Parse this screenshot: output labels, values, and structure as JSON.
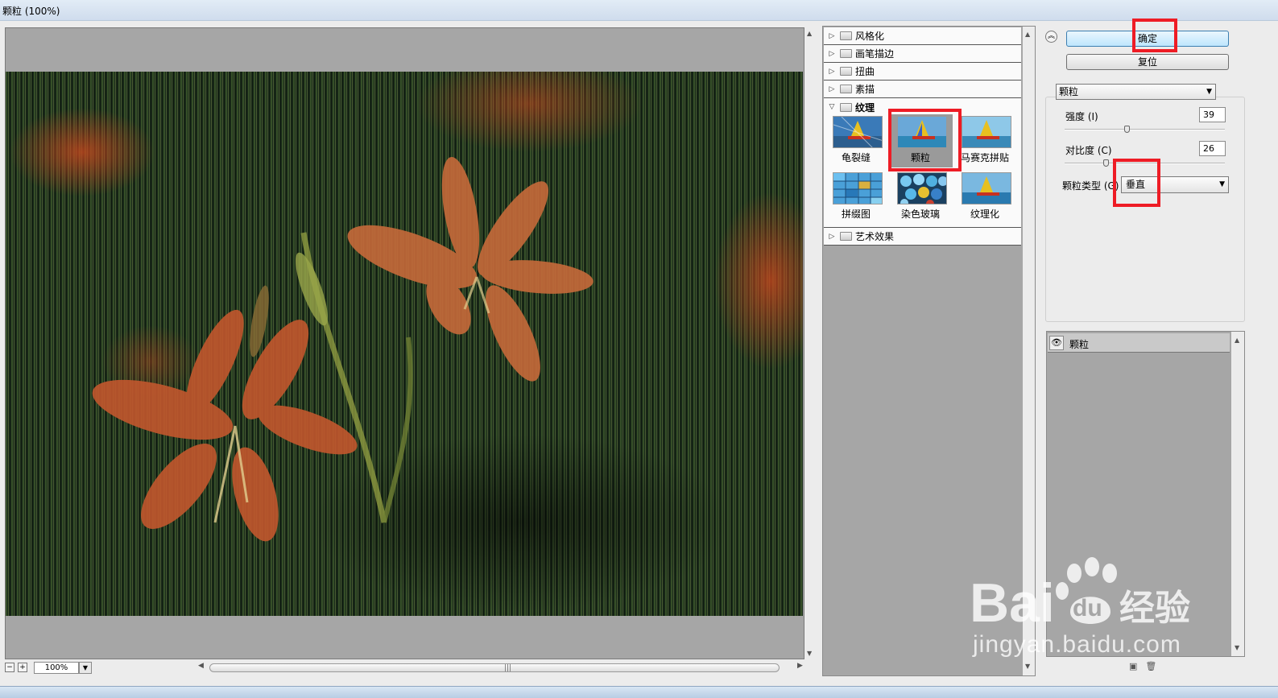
{
  "window": {
    "title": "颗粒 (100%)"
  },
  "preview": {
    "zoom": "100%"
  },
  "gallery": {
    "categories": [
      {
        "label": "风格化"
      },
      {
        "label": "画笔描边"
      },
      {
        "label": "扭曲"
      },
      {
        "label": "素描"
      },
      {
        "label": "纹理"
      },
      {
        "label": "艺术效果"
      }
    ],
    "thumbnails": [
      {
        "label": "龟裂缝"
      },
      {
        "label": "颗粒",
        "selected": true
      },
      {
        "label": "马赛克拼贴"
      },
      {
        "label": "拼缀图"
      },
      {
        "label": "染色玻璃"
      },
      {
        "label": "纹理化"
      }
    ]
  },
  "settings": {
    "ok_label": "确定",
    "reset_label": "复位",
    "filter_select": "颗粒",
    "intensity_label": "强度 (I)",
    "intensity_value": "39",
    "contrast_label": "对比度 (C)",
    "contrast_value": "26",
    "grain_type_label": "颗粒类型 (G)",
    "grain_type_value": "垂直",
    "intensity_fraction": 0.39,
    "contrast_fraction": 0.26
  },
  "layers": {
    "items": [
      {
        "label": "颗粒"
      }
    ]
  },
  "watermark": {
    "brand": "Baidu经验",
    "domain": "jingyan.baidu.com"
  },
  "colors": {
    "highlight_red": "#ee1c25",
    "panel_gray": "#a6a6a6",
    "ok_button": "#bee6fd"
  }
}
